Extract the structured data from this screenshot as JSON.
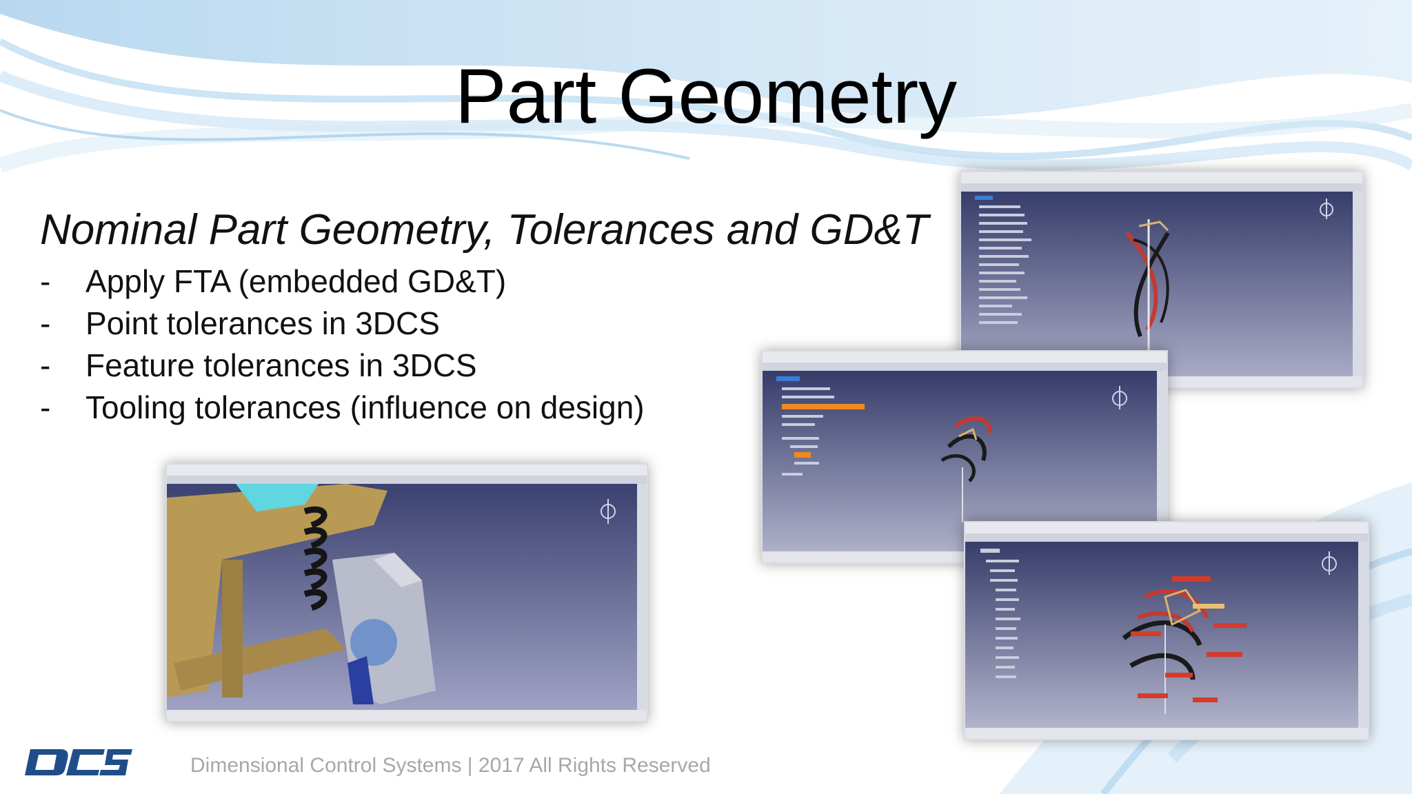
{
  "slide": {
    "title": "Part Geometry",
    "subtitle": "Nominal Part Geometry, Tolerances and GD&T",
    "bullets": [
      {
        "dash": "-",
        "text": "Apply FTA (embedded GD&T)"
      },
      {
        "dash": "-",
        "text": "Point tolerances in 3DCS"
      },
      {
        "dash": "-",
        "text": "Feature tolerances in 3DCS"
      },
      {
        "dash": "-",
        "text": "Tooling tolerances (influence on design)"
      }
    ],
    "footer": "Dimensional Control Systems | 2017 All Rights Reserved",
    "logo_text": "DCS"
  },
  "colors": {
    "accent_blue": "#1f4d8a",
    "viewport": "#39406a",
    "part_tan": "#b89a55",
    "annotation_red": "#d33c2a",
    "highlight_orange": "#f08a1e",
    "footer_gray": "#a7a7a7"
  }
}
